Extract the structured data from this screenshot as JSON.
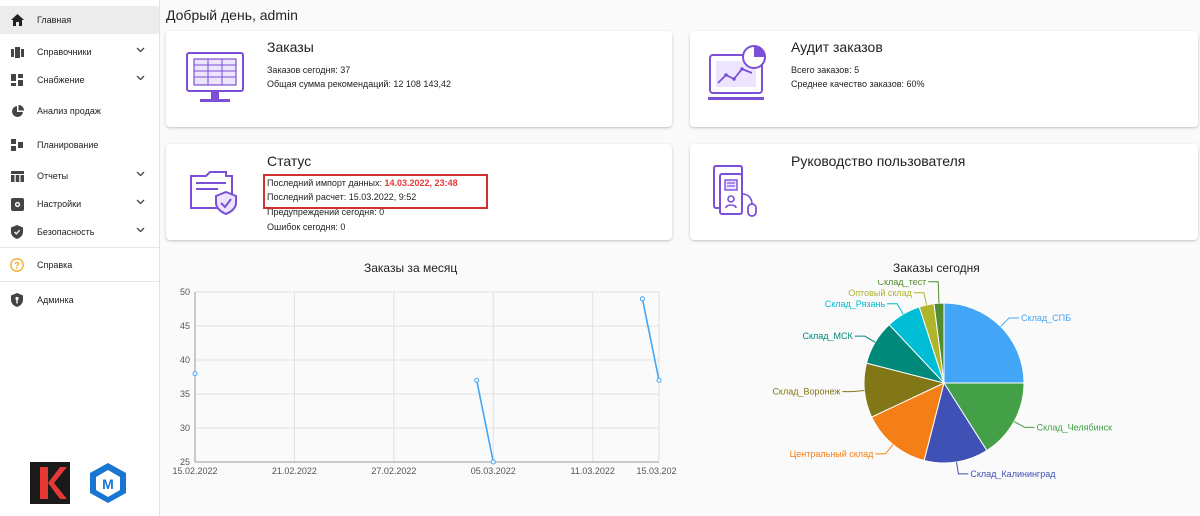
{
  "sidebar": {
    "items": [
      {
        "label": "Главная",
        "icon": "home-icon",
        "active": true,
        "has_chevron": false
      },
      {
        "label": "Справочники",
        "icon": "book-icon",
        "has_chevron": true
      },
      {
        "label": "Снабжение",
        "icon": "dashboard-icon",
        "has_chevron": true
      },
      {
        "label": "Анализ продаж",
        "icon": "pie-chart-icon",
        "has_chevron": false
      },
      {
        "label": "Планирование",
        "icon": "planning-icon",
        "has_chevron": false
      },
      {
        "label": "Отчеты",
        "icon": "table-icon",
        "has_chevron": true
      },
      {
        "label": "Настройки",
        "icon": "settings-icon",
        "has_chevron": true
      },
      {
        "label": "Безопасность",
        "icon": "shield-icon",
        "has_chevron": true
      },
      {
        "label": "Справка",
        "icon": "help-icon",
        "has_chevron": false
      },
      {
        "label": "Админка",
        "icon": "admin-shield-icon",
        "has_chevron": false
      }
    ]
  },
  "greeting": "Добрый день, admin",
  "cards": {
    "orders": {
      "title": "Заказы",
      "line1": "Заказов сегодня: 37",
      "line2": "Общая сумма рекомендаций: 12 108 143,42"
    },
    "audit": {
      "title": "Аудит заказов",
      "line1": "Всего заказов: 5",
      "line2": "Среднее качество заказов: 60%"
    },
    "status": {
      "title": "Статус",
      "import_label": "Последний импорт данных: ",
      "import_value": "14.03.2022, 23:48",
      "calc_line": "Последний расчет: 15.03.2022, 9:52",
      "warnings_line": "Предупреждений сегодня: 0",
      "errors_line": "Ошибок сегодня: 0"
    },
    "manual": {
      "title": "Руководство пользователя"
    }
  },
  "colors": {
    "accent_purple": "#7b4fd6",
    "highlight_red": "#d32f2f",
    "line_blue": "#42a5f5"
  },
  "chart_data": [
    {
      "type": "line",
      "title": "Заказы за месяц",
      "x_ticks": [
        "15.02.2022",
        "21.02.2022",
        "27.02.2022",
        "05.03.2022",
        "11.03.2022",
        "15.03.2022"
      ],
      "ylim": [
        25,
        50
      ],
      "y_ticks": [
        25,
        30,
        35,
        40,
        45,
        50
      ],
      "grid": true,
      "series": [
        {
          "values": [
            {
              "x": "15.02.2022",
              "y": 38
            }
          ]
        },
        {
          "values": [
            {
              "x": "04.03.2022",
              "y": 37
            },
            {
              "x": "05.03.2022",
              "y": 25
            }
          ]
        },
        {
          "values": [
            {
              "x": "14.03.2022",
              "y": 49
            },
            {
              "x": "15.03.2022",
              "y": 37
            }
          ]
        }
      ]
    },
    {
      "type": "pie",
      "title": "Заказы сегодня",
      "slices": [
        {
          "label": "Склад_СПБ",
          "value": 25,
          "color": "#42a5f5"
        },
        {
          "label": "Склад_Челябинск",
          "value": 16,
          "color": "#43a047"
        },
        {
          "label": "Склад_Калининград",
          "value": 13,
          "color": "#3f51b5"
        },
        {
          "label": "Центральный склад",
          "value": 14,
          "color": "#f57f17"
        },
        {
          "label": "Склад_Воронеж",
          "value": 11,
          "color": "#827717"
        },
        {
          "label": "Склад_МСК",
          "value": 9,
          "color": "#00897b"
        },
        {
          "label": "Склад_Рязань",
          "value": 7,
          "color": "#00bcd4"
        },
        {
          "label": "Оптовый склад",
          "value": 3,
          "color": "#afb42b"
        },
        {
          "label": "Склад_тест",
          "value": 2,
          "color": "#558b2f"
        }
      ]
    }
  ]
}
